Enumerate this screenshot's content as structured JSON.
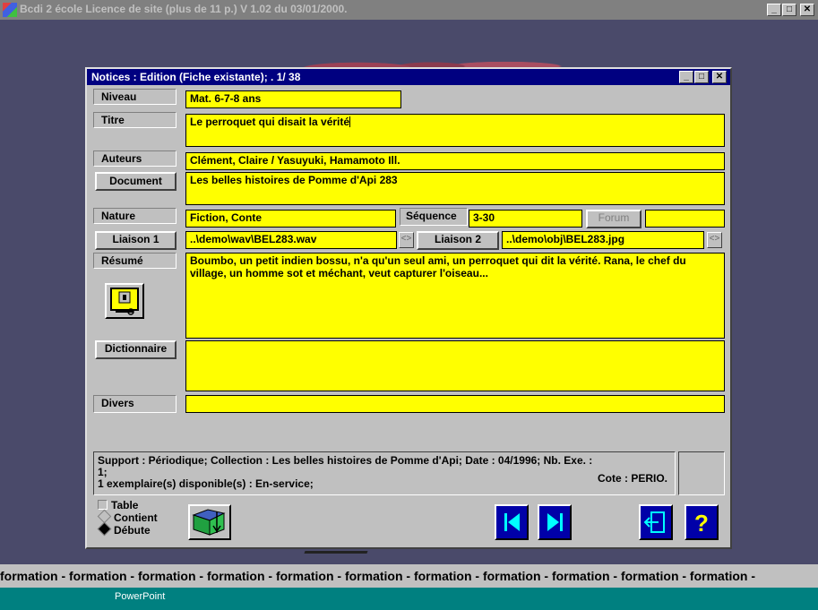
{
  "app": {
    "title": "Bcdi 2 école Licence de site (plus de 11 p.)  V 1.02 du 03/01/2000.",
    "marquee": "formation - formation - formation - formation - formation - formation - formation - formation - formation - formation - formation -",
    "taskbar_item": "PowerPoint"
  },
  "dialog": {
    "title": "Notices : Edition (Fiche existante); . 1/ 38",
    "labels": {
      "niveau": "Niveau",
      "titre": "Titre",
      "auteurs": "Auteurs",
      "nature": "Nature",
      "sequence": "Séquence",
      "resume": "Résumé",
      "divers": "Divers"
    },
    "buttons": {
      "document": "Document",
      "liaison1": "Liaison 1",
      "liaison2": "Liaison 2",
      "forum": "Forum",
      "dictionnaire": "Dictionnaire"
    },
    "fields": {
      "niveau": "Mat. 6-7-8 ans",
      "titre": "Le perroquet qui disait la vérité",
      "auteurs": "Clément, Claire / Yasuyuki, Hamamoto Ill.",
      "document": "Les belles histoires de Pomme d'Api 283",
      "nature": "Fiction, Conte",
      "sequence": "3-30",
      "forum_value": "",
      "liaison1": "..\\demo\\wav\\BEL283.wav",
      "liaison2": "..\\demo\\obj\\BEL283.jpg",
      "resume": "Boumbo, un petit indien bossu, n'a qu'un seul ami, un perroquet qui dit la vérité. Rana, le chef du village, un homme sot et méchant, veut capturer l'oiseau...",
      "dictionnaire": "",
      "divers": ""
    },
    "spin_glyph": "<>",
    "status": {
      "line1": "Support : Périodique;  Collection : Les belles histoires de Pomme d'Api;  Date : 04/1996;  Nb. Exe. :",
      "line2": "1;",
      "line3": "1 exemplaire(s) disponible(s)  :  En-service;",
      "cote": "Cote : PERIO."
    },
    "search_options": {
      "table": "Table",
      "contient": "Contient",
      "debute": "Débute",
      "selected": "Débute"
    }
  },
  "colors": {
    "field_bg": "#ffff00",
    "titlebar_active": "#000080",
    "nav_button": "#0000a8",
    "desktop": "#4a4a6a"
  }
}
